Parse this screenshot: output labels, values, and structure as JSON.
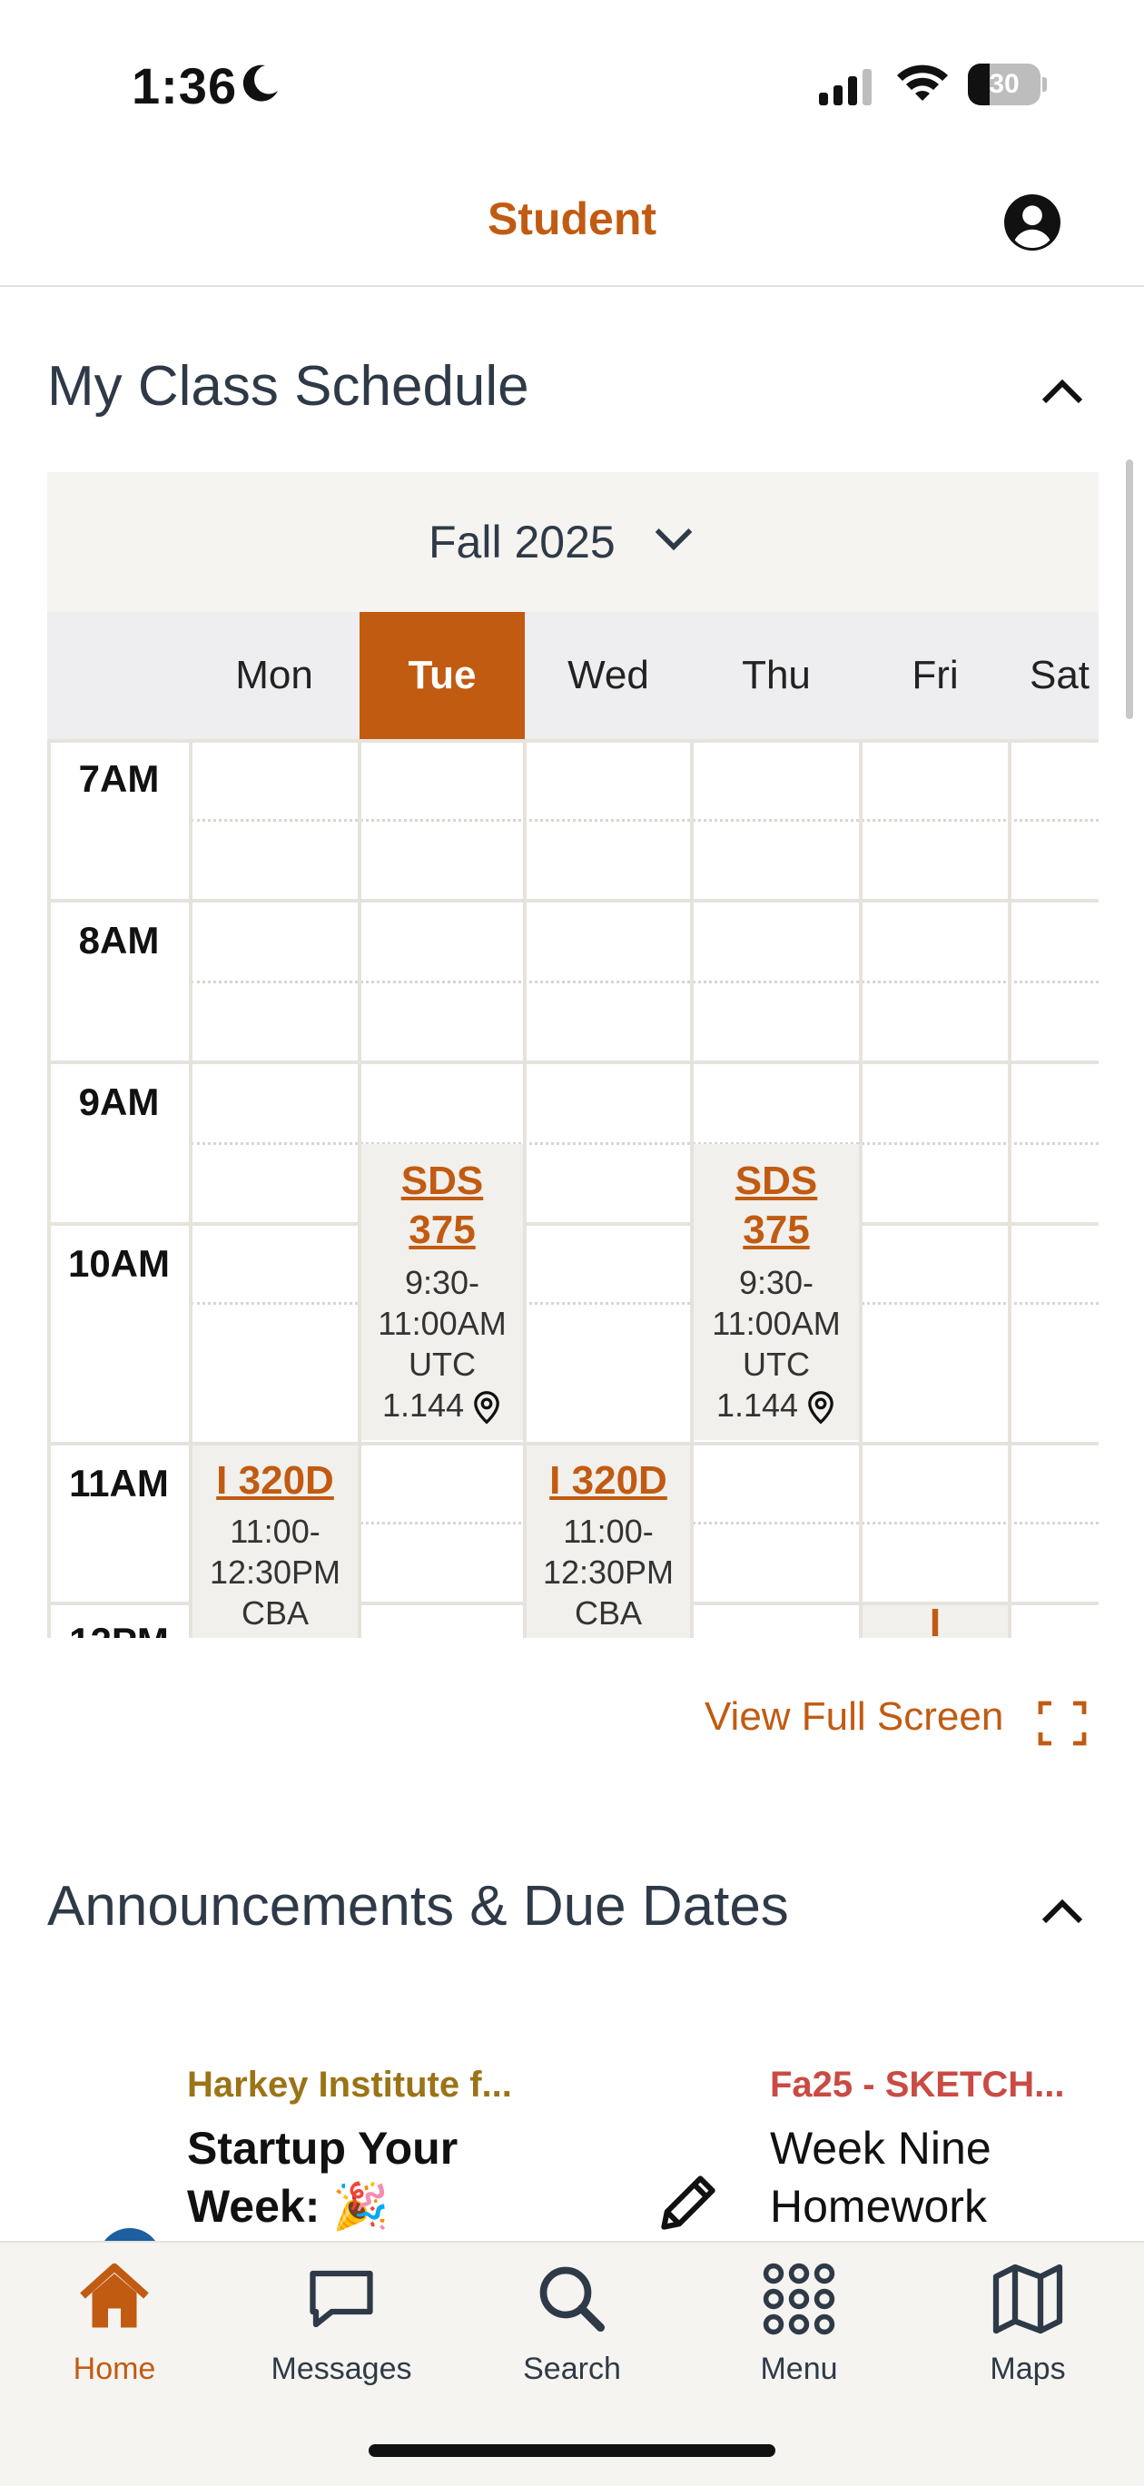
{
  "status_bar": {
    "time": "1:36",
    "battery": "30",
    "battery_level_percent": 30
  },
  "header": {
    "title": "Student"
  },
  "schedule": {
    "section_title": "My Class Schedule",
    "term": "Fall 2025",
    "days": [
      "Mon",
      "Tue",
      "Wed",
      "Thu",
      "Fri",
      "Sat"
    ],
    "active_day": "Tue",
    "hours": [
      "7AM",
      "8AM",
      "9AM",
      "10AM",
      "11AM",
      "12PM"
    ],
    "events": [
      {
        "title_line1": "SDS",
        "title_line2": "375",
        "time_line1": "9:30-",
        "time_line2": "11:00AM",
        "location_line1": "UTC",
        "location_line2": "1.144",
        "day": "Tue"
      },
      {
        "title_line1": "SDS",
        "title_line2": "375",
        "time_line1": "9:30-",
        "time_line2": "11:00AM",
        "location_line1": "UTC",
        "location_line2": "1.144",
        "day": "Thu"
      },
      {
        "title_line1": "I 320D",
        "time_line1": "11:00-",
        "time_line2": "12:30PM",
        "location_line1": "CBA",
        "day": "Mon"
      },
      {
        "title_line1": "I 320D",
        "time_line1": "11:00-",
        "time_line2": "12:30PM",
        "location_line1": "CBA",
        "day": "Wed"
      },
      {
        "title_line1": "I",
        "day": "Fri"
      }
    ],
    "view_full_screen": "View Full Screen"
  },
  "announcements": {
    "section_title": "Announcements & Due Dates",
    "cards": [
      {
        "org": "Harkey Institute f...",
        "title": "Startup Your Week: 🎉"
      },
      {
        "org": "Fa25 - SKETCH...",
        "title": "Week Nine Homework"
      }
    ]
  },
  "nav": {
    "items": [
      {
        "label": "Home",
        "icon": "home-icon"
      },
      {
        "label": "Messages",
        "icon": "messages-icon"
      },
      {
        "label": "Search",
        "icon": "search-icon"
      },
      {
        "label": "Menu",
        "icon": "menu-grid-icon"
      },
      {
        "label": "Maps",
        "icon": "map-icon"
      }
    ]
  },
  "colors": {
    "accent": "#c15b12",
    "org_gold": "#9a7416",
    "org_red": "#c94b44"
  }
}
